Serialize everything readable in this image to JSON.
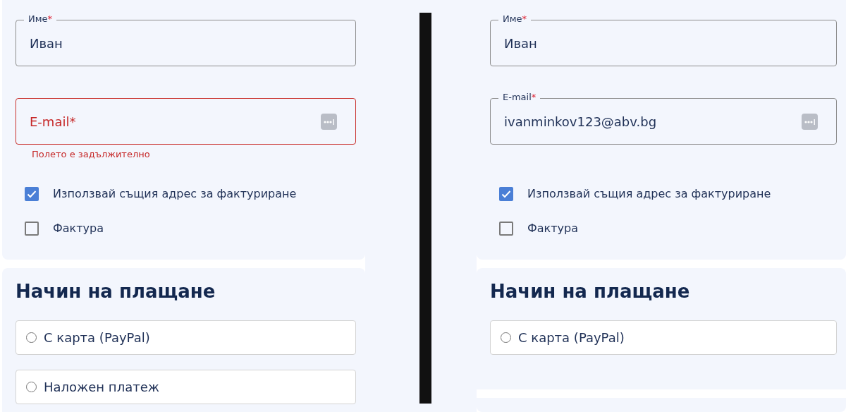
{
  "panels": [
    {
      "fields": [
        {
          "kind": "text",
          "label": "Име",
          "required_mark": "*",
          "value": "Иван",
          "invalid": false
        },
        {
          "kind": "email",
          "label": "E-mail",
          "required_mark": "*",
          "error": "Полето е задължително",
          "invalid": true
        }
      ],
      "checkboxes": [
        {
          "label": "Използвай същия адрес за фактуриране",
          "checked": true
        },
        {
          "label": "Фактура",
          "checked": false
        }
      ],
      "payment": {
        "title": "Начин на плащане",
        "options": [
          {
            "label": "С карта (PayPal)",
            "selected": false
          },
          {
            "label": "Наложен платеж",
            "selected": false
          }
        ]
      }
    },
    {
      "fields": [
        {
          "kind": "text",
          "label": "Име",
          "required_mark": "*",
          "value": "Иван",
          "invalid": false
        },
        {
          "kind": "email",
          "label": "E-mail",
          "required_mark": "*",
          "value": "ivanminkov123@abv.bg",
          "invalid": false
        }
      ],
      "checkboxes": [
        {
          "label": "Използвай същия адрес за фактуриране",
          "checked": true
        },
        {
          "label": "Фактура",
          "checked": false
        }
      ],
      "payment": {
        "title": "Начин на плащане",
        "options": [
          {
            "label": "С карта (PayPal)",
            "selected": false
          }
        ]
      }
    }
  ]
}
